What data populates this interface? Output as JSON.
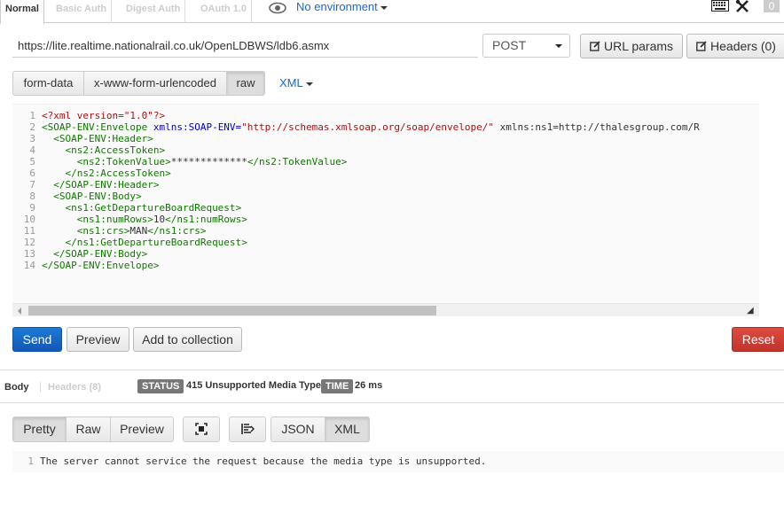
{
  "auth_tabs": [
    "Normal",
    "Basic Auth",
    "Digest Auth",
    "OAuth 1.0"
  ],
  "environment": {
    "label": "No environment",
    "icon": "eye-icon"
  },
  "top_icons": {
    "keyboard": "keyboard-icon",
    "tools": "tools-icon",
    "count": "0"
  },
  "request": {
    "url": "https://lite.realtime.nationalrail.co.uk/OpenLDBWS/ldb6.asmx",
    "method": "POST",
    "url_params_label": "URL params",
    "headers_label": "Headers (0)"
  },
  "body_types": [
    "form-data",
    "x-www-form-urlencoded",
    "raw"
  ],
  "body_type_selected": "raw",
  "raw_format": "XML",
  "editor": {
    "line_numbers": [
      "1",
      "2",
      "3",
      "4",
      "5",
      "6",
      "7",
      "8",
      "9",
      "10",
      "11",
      "12",
      "13",
      "14"
    ],
    "lines": [
      "<?xml version=\"1.0\"?>",
      "<SOAP-ENV:Envelope xmlns:SOAP-ENV=\"http://schemas.xmlsoap.org/soap/envelope/\" xmlns:ns1=\"http://thalesgroup.com/R",
      "  <SOAP-ENV:Header>",
      "    <ns2:AccessToken>",
      "      <ns2:TokenValue>*************</ns2:TokenValue>",
      "    </ns2:AccessToken>",
      "  </SOAP-ENV:Header>",
      "  <SOAP-ENV:Body>",
      "    <ns1:GetDepartureBoardRequest>",
      "      <ns1:numRows>10</ns1:numRows>",
      "      <ns1:crs>MAN</ns1:crs>",
      "    </ns1:GetDepartureBoardRequest>",
      "  </SOAP-ENV:Body>",
      "</SOAP-ENV:Envelope>"
    ]
  },
  "actions": {
    "send": "Send",
    "preview": "Preview",
    "add_to_collection": "Add to collection",
    "reset": "Reset"
  },
  "response": {
    "tabs": [
      "Body",
      "Headers (8)"
    ],
    "status_label": "STATUS",
    "status_value": "415 Unsupported Media Type",
    "time_label": "TIME",
    "time_value": "26 ms",
    "view_modes": [
      "Pretty",
      "Raw",
      "Preview"
    ],
    "view_selected": "Pretty",
    "formats": [
      "JSON",
      "XML"
    ],
    "format_selected": "XML",
    "line_number": "1",
    "body_text": "The server cannot service the request because the media type is unsupported."
  },
  "colors": {
    "send": "#1565c0",
    "reset": "#d13b31",
    "link": "#1a69c7",
    "xml_tag": "#117700",
    "xml_attr": "#0000cc",
    "xml_string": "#aa1111",
    "xml_pi": "#aa1111"
  }
}
